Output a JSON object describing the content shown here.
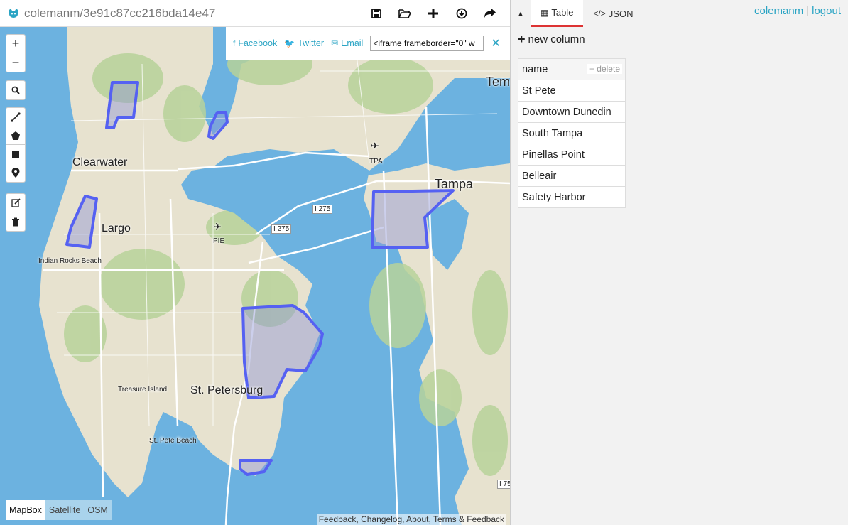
{
  "topbar": {
    "title": "colemanm/3e91c87cc216bda14e47",
    "actions": [
      "save-icon",
      "open-icon",
      "plus-icon",
      "download-icon",
      "share-icon"
    ]
  },
  "panel": {
    "tabs": [
      {
        "label": "Table",
        "icon": "table-icon"
      },
      {
        "label": "JSON",
        "icon": "code-icon"
      }
    ],
    "user": "colemanm",
    "logout": "logout",
    "new_column": "new column",
    "table": {
      "header": "name",
      "delete_label": "delete",
      "rows": [
        "St Pete",
        "Downtown Dunedin",
        "South Tampa",
        "Pinellas Point",
        "Belleair",
        "Safety Harbor"
      ]
    }
  },
  "share": {
    "facebook": "Facebook",
    "twitter": "Twitter",
    "email": "Email",
    "embed_value": "<iframe frameborder=\"0\" w"
  },
  "map": {
    "labels": {
      "clearwater": "Clearwater",
      "largo": "Largo",
      "tampa": "Tampa",
      "tem": "Tem",
      "st_petersburg": "St. Petersburg",
      "indian_rocks": "Indian Rocks Beach",
      "treasure_island": "Treasure Island",
      "st_pete_beach": "St. Pete Beach",
      "tpa": "TPA",
      "pie": "PIE",
      "i275_a": "I 275",
      "i275_b": "I 275",
      "i75": "I 75"
    },
    "layers": [
      "MapBox",
      "Satellite",
      "OSM"
    ],
    "active_layer": "MapBox",
    "footer": "Feedback, Changelog, About, Terms & Feedback"
  },
  "colors": {
    "accent": "#2aa4c4",
    "water": "#6cb2e0",
    "land": "#e7e2cf",
    "polygon": "#5561f2"
  }
}
